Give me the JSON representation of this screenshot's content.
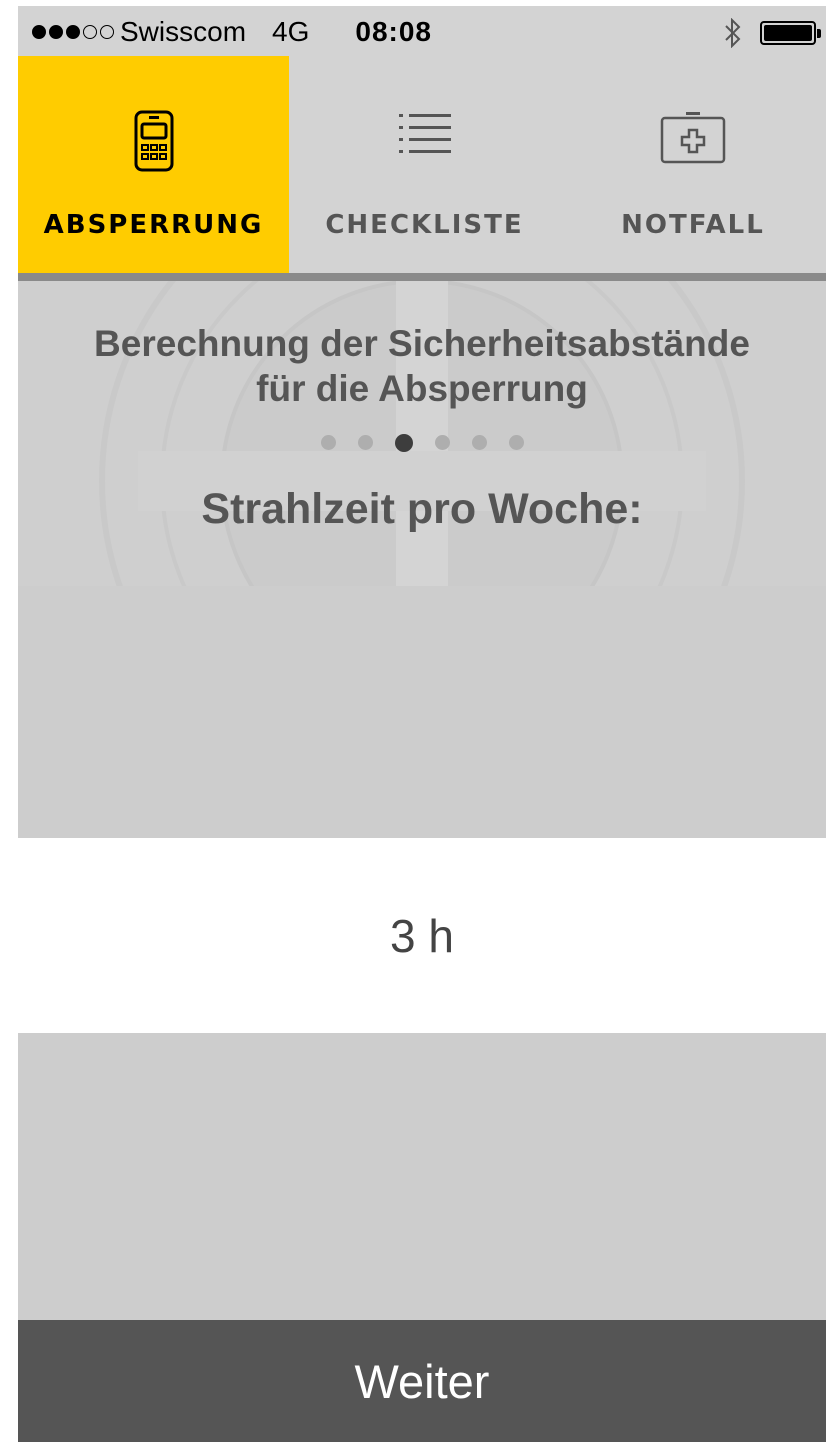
{
  "status_bar": {
    "carrier": "Swisscom",
    "network": "4G",
    "time": "08:08",
    "signal_bars_filled": 3,
    "signal_bars_total": 5,
    "battery_level": 1.0
  },
  "tabs": [
    {
      "label": "ABSPERRUNG",
      "icon": "dosimeter-icon",
      "active": true
    },
    {
      "label": "CHECKLISTE",
      "icon": "list-icon",
      "active": false
    },
    {
      "label": "NOTFALL",
      "icon": "first-aid-kit-icon",
      "active": false
    }
  ],
  "header": {
    "title_line1": "Berechnung der Sicherheitsabstände",
    "title_line2": "für die Absperrung",
    "pages_total": 6,
    "current_page": 3,
    "question": "Strahlzeit pro Woche:"
  },
  "picker": {
    "selected_value": "3 h"
  },
  "footer": {
    "next_label": "Weiter"
  },
  "colors": {
    "accent": "#ffcc00",
    "background": "#d3d3d3",
    "button": "#555555",
    "text_dark": "#555555"
  }
}
